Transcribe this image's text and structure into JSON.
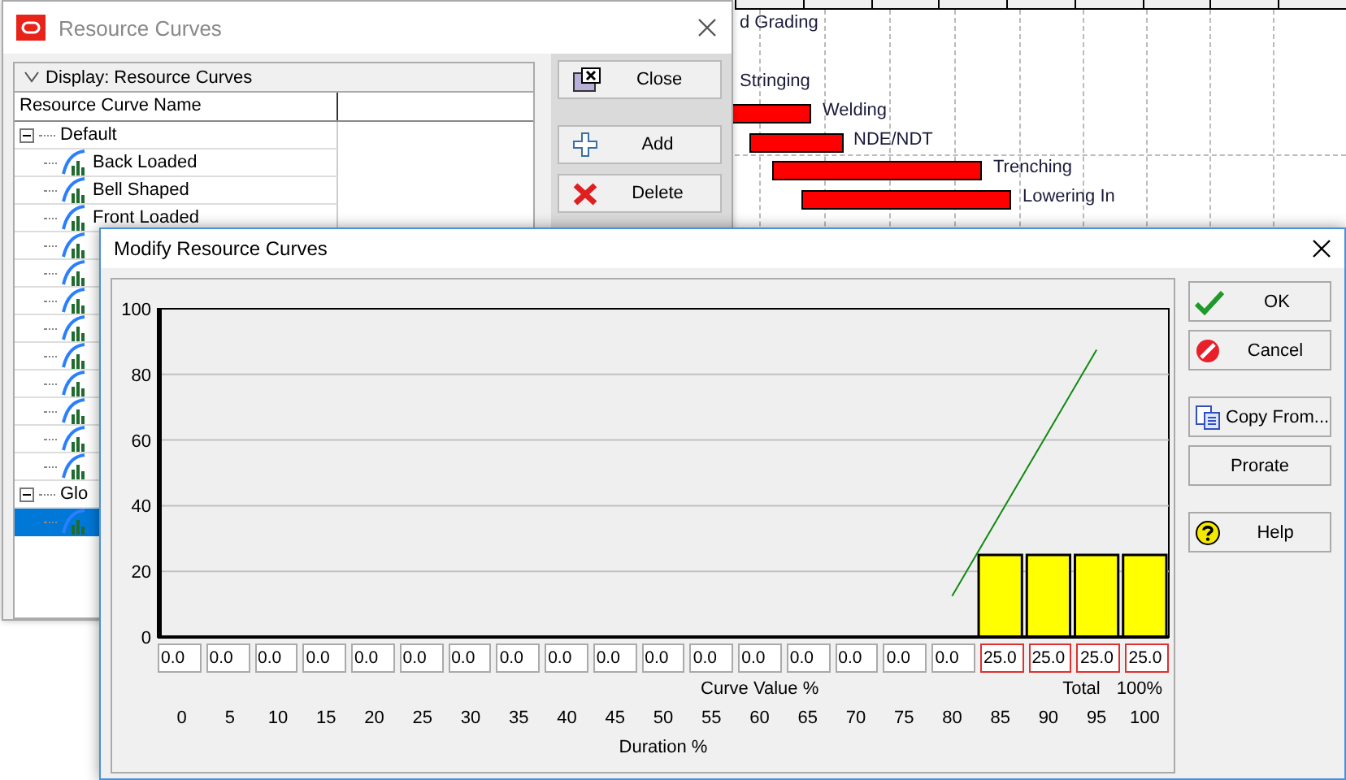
{
  "gantt": {
    "items": [
      {
        "label": "d Grading",
        "bar": false
      },
      {
        "label": "Stringing",
        "bar": false
      },
      {
        "label": "Welding",
        "bar": true
      },
      {
        "label": "NDE/NDT",
        "bar": true
      },
      {
        "label": "Trenching",
        "bar": true
      },
      {
        "label": "Lowering In",
        "bar": true
      }
    ]
  },
  "resource_window": {
    "title": "Resource Curves",
    "display_bar": "Display: Resource Curves",
    "column": "Resource Curve Name",
    "tree": [
      {
        "label": "Default",
        "expanded": true,
        "children": [
          {
            "label": "Back Loaded",
            "selected": false
          },
          {
            "label": "Bell Shaped",
            "selected": false
          },
          {
            "label": "Front Loaded",
            "selected": false
          },
          {
            "selected": false
          },
          {
            "selected": false
          },
          {
            "selected": false
          },
          {
            "selected": false
          },
          {
            "selected": false
          },
          {
            "selected": false
          },
          {
            "selected": false
          },
          {
            "selected": false
          },
          {
            "selected": false
          }
        ]
      },
      {
        "label": "Glo",
        "expanded": true,
        "children": [
          {
            "selected": true
          }
        ]
      }
    ],
    "buttons": [
      {
        "kind": "close",
        "label": "Close"
      },
      {
        "kind": "add",
        "label": "Add"
      },
      {
        "kind": "delete",
        "label": "Delete"
      }
    ]
  },
  "modify_dialog": {
    "title": "Modify Resource Curves",
    "chart_data": {
      "type": "bar",
      "xlabel": "Duration %",
      "categories": [
        "0",
        "5",
        "10",
        "15",
        "20",
        "25",
        "30",
        "35",
        "40",
        "45",
        "50",
        "55",
        "60",
        "65",
        "70",
        "75",
        "80",
        "85",
        "90",
        "95",
        "100"
      ],
      "grid": true,
      "series": [
        {
          "color": "#ffff00",
          "values": [
            0,
            0,
            0,
            0,
            0,
            0,
            0,
            0,
            0,
            0,
            0,
            0,
            0,
            0,
            0,
            0,
            0,
            25,
            25,
            25,
            25
          ]
        },
        {
          "type": "line",
          "color": "#118a11",
          "values": [
            null,
            null,
            null,
            null,
            null,
            null,
            null,
            null,
            null,
            null,
            null,
            null,
            null,
            null,
            null,
            null,
            12.5,
            37.5,
            62.5,
            87.5,
            null
          ]
        }
      ],
      "ylim": [
        0,
        100
      ],
      "yticks": [
        0,
        20,
        40,
        60,
        80,
        100
      ]
    },
    "curve_values": [
      {
        "value": "0.0",
        "highlighted": false
      },
      {
        "value": "0.0",
        "highlighted": false
      },
      {
        "value": "0.0",
        "highlighted": false
      },
      {
        "value": "0.0",
        "highlighted": false
      },
      {
        "value": "0.0",
        "highlighted": false
      },
      {
        "value": "0.0",
        "highlighted": false
      },
      {
        "value": "0.0",
        "highlighted": false
      },
      {
        "value": "0.0",
        "highlighted": false
      },
      {
        "value": "0.0",
        "highlighted": false
      },
      {
        "value": "0.0",
        "highlighted": false
      },
      {
        "value": "0.0",
        "highlighted": false
      },
      {
        "value": "0.0",
        "highlighted": false
      },
      {
        "value": "0.0",
        "highlighted": false
      },
      {
        "value": "0.0",
        "highlighted": false
      },
      {
        "value": "0.0",
        "highlighted": false
      },
      {
        "value": "0.0",
        "highlighted": false
      },
      {
        "value": "0.0",
        "highlighted": false
      },
      {
        "value": "25.0",
        "highlighted": true
      },
      {
        "value": "25.0",
        "highlighted": true
      },
      {
        "value": "25.0",
        "highlighted": true
      },
      {
        "value": "25.0",
        "highlighted": true
      }
    ],
    "curve_value_label": "Curve Value %",
    "total_label": "Total",
    "total": "100%",
    "buttons": [
      {
        "kind": "ok",
        "label": "OK"
      },
      {
        "kind": "cancel",
        "label": "Cancel"
      },
      {
        "kind": "copy",
        "label": "Copy From..."
      },
      {
        "kind": "plain",
        "label": "Prorate"
      },
      {
        "kind": "help",
        "label": "Help"
      }
    ]
  }
}
